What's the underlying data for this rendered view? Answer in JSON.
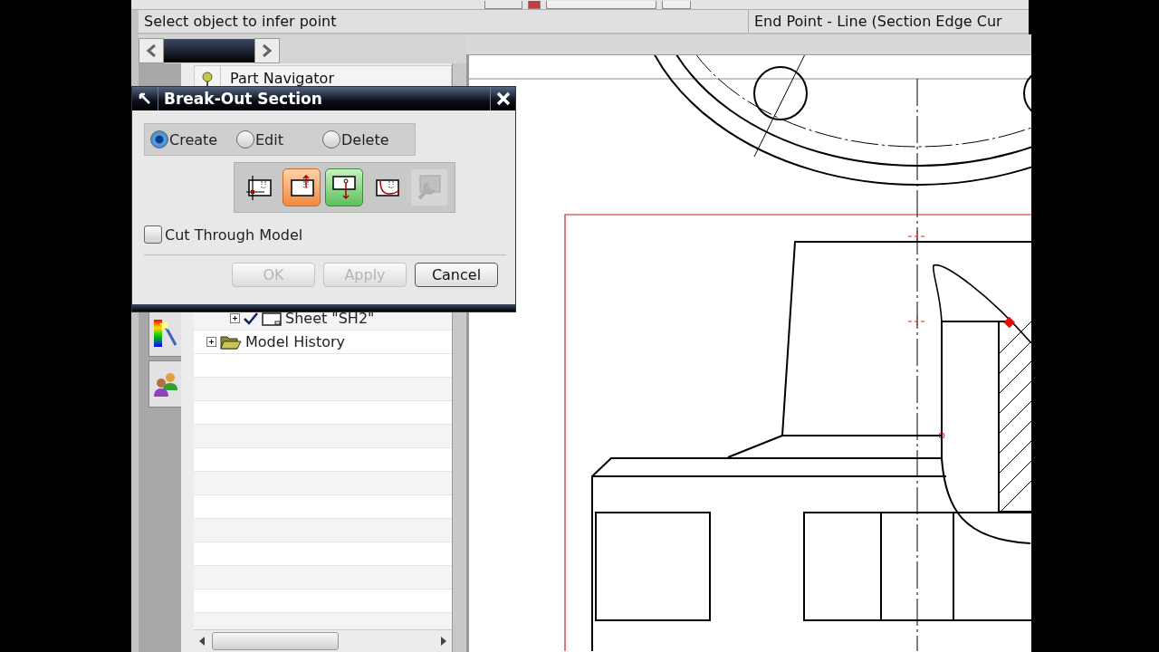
{
  "status_bar": {
    "prompt": "Select object to infer point",
    "snap_info": "End Point - Line (Section Edge Cur"
  },
  "navigator": {
    "title": "Part Navigator",
    "items": [
      {
        "label": "Sheet \"SH2\"",
        "kind": "sheet",
        "checked": true
      },
      {
        "label": "Model History",
        "kind": "folder",
        "checked": false
      }
    ]
  },
  "dialog": {
    "title": "Break-Out Section",
    "modes": [
      {
        "label": "Create",
        "selected": true
      },
      {
        "label": "Edit",
        "selected": false
      },
      {
        "label": "Delete",
        "selected": false
      }
    ],
    "tools": [
      {
        "kind": "point",
        "selected": false,
        "hovered": false,
        "disabled": false
      },
      {
        "kind": "vector",
        "selected": true,
        "hovered": false,
        "disabled": false
      },
      {
        "kind": "extend",
        "selected": false,
        "hovered": true,
        "disabled": false
      },
      {
        "kind": "curve",
        "selected": false,
        "hovered": false,
        "disabled": false
      },
      {
        "kind": "modify",
        "selected": false,
        "hovered": false,
        "disabled": true
      }
    ],
    "cut_through": {
      "label": "Cut Through Model",
      "checked": false
    },
    "buttons": [
      {
        "label": "OK",
        "disabled": true
      },
      {
        "label": "Apply",
        "disabled": true
      },
      {
        "label": "Cancel",
        "disabled": false
      }
    ]
  }
}
